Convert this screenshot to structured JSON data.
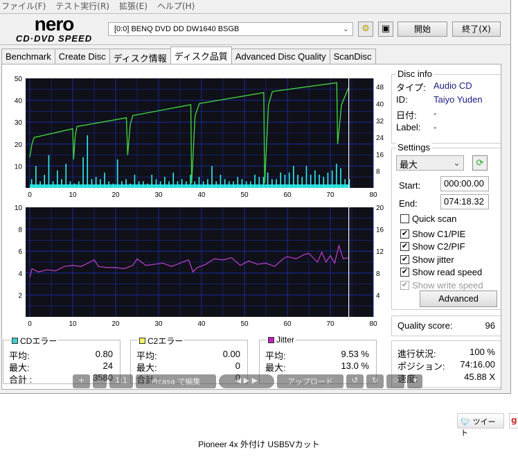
{
  "menu": [
    "ファイル(F)",
    "テスト実行(R)",
    "拡張(E)",
    "ヘルプ(H)"
  ],
  "logo": {
    "line1": "nero",
    "line2": "CD·DVD SPEED"
  },
  "drive": "[0:0]  BENQ DVD DD DW1640 BSGB",
  "buttons": {
    "start": "開始",
    "exit": "終了(X)",
    "advanced": "Advanced"
  },
  "tabs": [
    "Benchmark",
    "Create Disc",
    "ディスク情報",
    "ディスク品質",
    "Advanced Disc Quality",
    "ScanDisc"
  ],
  "active_tab": "ディスク品質",
  "disc_info": {
    "title": "Disc info",
    "rows": [
      {
        "k": "タイプ:",
        "v": "Audio CD"
      },
      {
        "k": "ID:",
        "v": "Taiyo Yuden"
      },
      {
        "k": "日付:",
        "v": "-"
      },
      {
        "k": "Label:",
        "v": "-"
      }
    ]
  },
  "settings": {
    "title": "Settings",
    "speed": "最大",
    "start_label": "Start:",
    "start": "000:00.00",
    "end_label": "End:",
    "end": "074:18.32",
    "checks": [
      {
        "label": "Quick scan",
        "checked": false,
        "disabled": false
      },
      {
        "label": "Show C1/PIE",
        "checked": true,
        "disabled": false
      },
      {
        "label": "Show C2/PIF",
        "checked": true,
        "disabled": false
      },
      {
        "label": "Show jitter",
        "checked": true,
        "disabled": false
      },
      {
        "label": "Show read speed",
        "checked": true,
        "disabled": false
      },
      {
        "label": "Show write speed",
        "checked": true,
        "disabled": true
      }
    ]
  },
  "quality": {
    "label": "Quality score:",
    "value": "96"
  },
  "progress": {
    "rows": [
      {
        "k": "進行状況:",
        "v": "100 %"
      },
      {
        "k": "ポジション:",
        "v": "74:16.00"
      },
      {
        "k": "速度:",
        "v": "45.88 X"
      }
    ]
  },
  "stats": [
    {
      "title": "CDエラー",
      "color": "#40d0d0",
      "rows": [
        {
          "k": "平均:",
          "v": "0.80"
        },
        {
          "k": "最大:",
          "v": "24"
        },
        {
          "k": "合計 :",
          "v": "3580"
        }
      ]
    },
    {
      "title": "C2エラー",
      "color": "#f0f060",
      "rows": [
        {
          "k": "平均:",
          "v": "0.00"
        },
        {
          "k": "最大:",
          "v": "0"
        },
        {
          "k": "合計 :",
          "v": "0"
        }
      ]
    },
    {
      "title": "Jitter",
      "color": "#c020c0",
      "rows": [
        {
          "k": "平均:",
          "v": "9.53 %"
        },
        {
          "k": "最大:",
          "v": "13.0 %"
        }
      ]
    }
  ],
  "picasa": {
    "plus": "+",
    "minus": "-",
    "one": "1:1",
    "edit": "Picasa で編集",
    "upload": "アップロード"
  },
  "tweet": "ツイート",
  "gplus": "g",
  "caption": "Pioneer 4x 外付け USB5Vカット",
  "colors": {
    "plot_bg": "#101018",
    "grid": "#1a2a9a",
    "c1": "#30f0f0",
    "speed": "#40d040",
    "jitter": "#c040d0",
    "end_marker": "#ffffff"
  },
  "chart_data": [
    {
      "type": "bar+line",
      "title": "C1 errors / read speed",
      "xlim": [
        0,
        80
      ],
      "ylim_left": [
        0,
        50
      ],
      "ylim_right": [
        0,
        52
      ],
      "xticks": [
        0,
        10,
        20,
        30,
        40,
        50,
        60,
        70,
        80
      ],
      "yticks_left": [
        10,
        20,
        30,
        40,
        50
      ],
      "yticks_right": [
        8,
        16,
        24,
        32,
        40,
        48
      ],
      "end_position": 74.3,
      "c1_per_minute": [
        4,
        10,
        3,
        6,
        15,
        3,
        8,
        4,
        11,
        3,
        2,
        3,
        14,
        24,
        4,
        5,
        4,
        7,
        3,
        2,
        13,
        3,
        4,
        2,
        6,
        3,
        3,
        2,
        6,
        4,
        3,
        5,
        3,
        7,
        3,
        4,
        3,
        6,
        3,
        5,
        3,
        4,
        10,
        3,
        6,
        4,
        3,
        3,
        5,
        4,
        3,
        3,
        6,
        5,
        5,
        7,
        4,
        4,
        7,
        6,
        7,
        10,
        6,
        5,
        10,
        6,
        8,
        6,
        5,
        7,
        8,
        11,
        9,
        4,
        4
      ],
      "speed": [
        [
          0,
          14
        ],
        [
          0.5,
          20
        ],
        [
          1,
          23
        ],
        [
          10,
          27
        ],
        [
          10.2,
          13
        ],
        [
          10.6,
          24
        ],
        [
          11,
          28
        ],
        [
          22.5,
          32
        ],
        [
          22.8,
          15
        ],
        [
          23.4,
          29
        ],
        [
          24,
          33
        ],
        [
          37.5,
          38
        ],
        [
          37.7,
          2
        ],
        [
          38.5,
          33
        ],
        [
          39.5,
          38.5
        ],
        [
          54.5,
          43.5
        ],
        [
          54.7,
          2
        ],
        [
          55.6,
          38
        ],
        [
          56.5,
          44
        ],
        [
          71.5,
          48
        ],
        [
          71.7,
          20
        ],
        [
          72.6,
          38
        ],
        [
          74.3,
          46
        ]
      ]
    },
    {
      "type": "line",
      "title": "C2 errors / jitter",
      "xlim": [
        0,
        80
      ],
      "ylim_left": [
        0,
        10
      ],
      "ylim_right": [
        0,
        20
      ],
      "xticks": [
        0,
        10,
        20,
        30,
        40,
        50,
        60,
        70,
        80
      ],
      "yticks_left": [
        2,
        4,
        6,
        8,
        10
      ],
      "yticks_right": [
        4,
        8,
        12,
        16,
        20
      ],
      "c2_per_minute": [
        0
      ],
      "jitter": [
        [
          0,
          7.2
        ],
        [
          0.5,
          8.8
        ],
        [
          2,
          8.2
        ],
        [
          4,
          8.6
        ],
        [
          6,
          8.4
        ],
        [
          8,
          9.2
        ],
        [
          10,
          9.4
        ],
        [
          12,
          9.2
        ],
        [
          14,
          10.0
        ],
        [
          15,
          10.4
        ],
        [
          16,
          9.2
        ],
        [
          18,
          9.0
        ],
        [
          20,
          9.0
        ],
        [
          22,
          8.8
        ],
        [
          24,
          9.4
        ],
        [
          25,
          10.6
        ],
        [
          27,
          9.4
        ],
        [
          29,
          9.6
        ],
        [
          31,
          9.8
        ],
        [
          33,
          9.2
        ],
        [
          35,
          9.8
        ],
        [
          37,
          10.4
        ],
        [
          38,
          8.2
        ],
        [
          39,
          9.0
        ],
        [
          41,
          9.6
        ],
        [
          43,
          10.6
        ],
        [
          45,
          10.4
        ],
        [
          47,
          10.8
        ],
        [
          49,
          9.4
        ],
        [
          51,
          10.2
        ],
        [
          53,
          9.6
        ],
        [
          55,
          9.8
        ],
        [
          57,
          9.2
        ],
        [
          59,
          10.6
        ],
        [
          60,
          11.0
        ],
        [
          62,
          10.6
        ],
        [
          64,
          11.4
        ],
        [
          65,
          11.6
        ],
        [
          67,
          10.0
        ],
        [
          68,
          11.8
        ],
        [
          69,
          10.0
        ],
        [
          70,
          11.2
        ],
        [
          71,
          9.8
        ],
        [
          72,
          13.0
        ],
        [
          73,
          10.6
        ],
        [
          74.3,
          10.8
        ]
      ]
    }
  ]
}
